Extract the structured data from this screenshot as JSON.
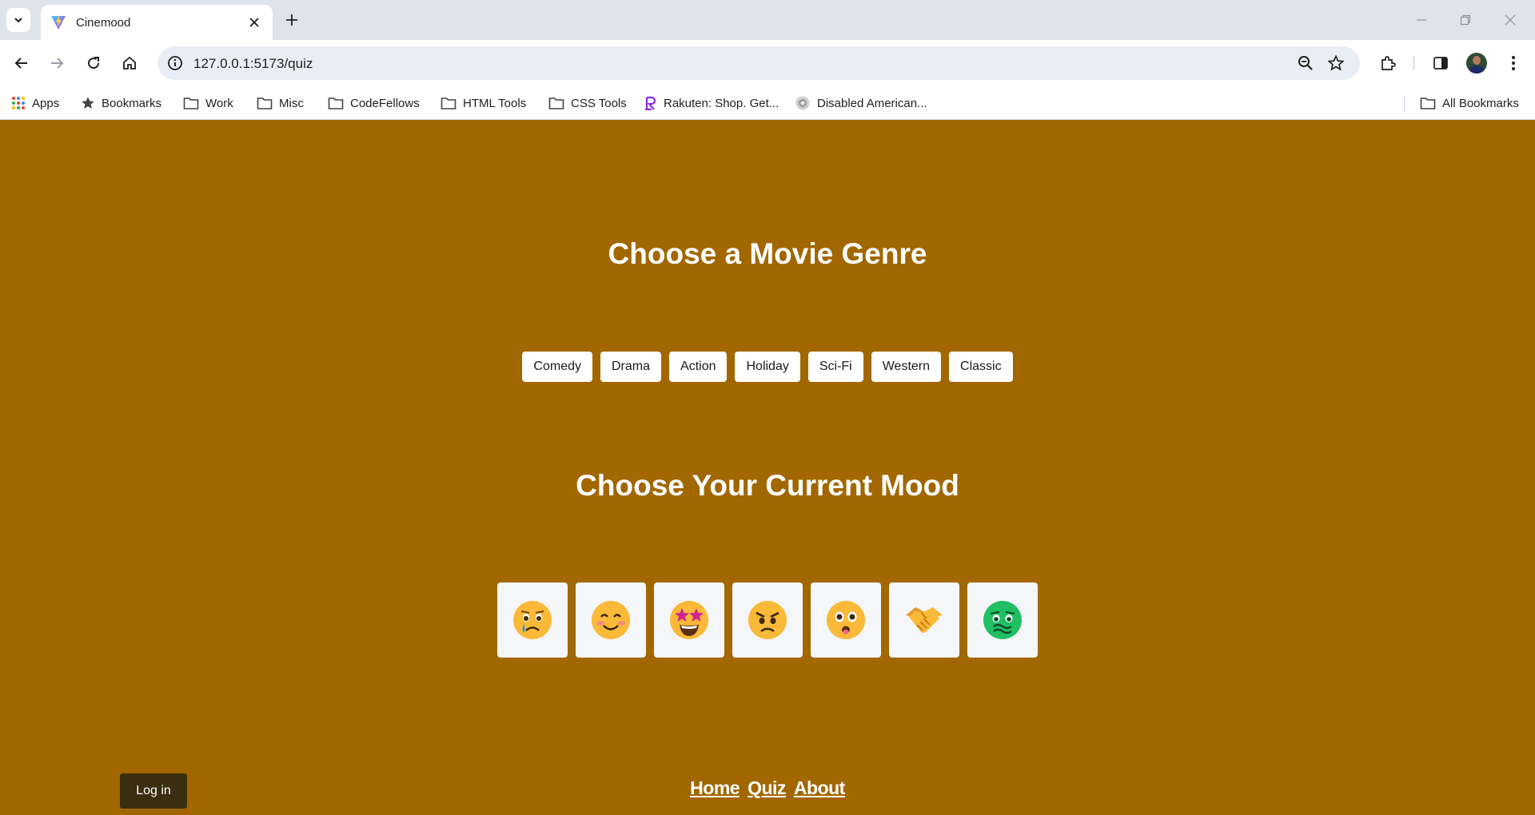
{
  "browser": {
    "tab_title": "Cinemood",
    "url": "127.0.0.1:5173/quiz",
    "bookmarks": [
      {
        "label": "Apps",
        "icon": "apps-grid-icon"
      },
      {
        "label": "Bookmarks",
        "icon": "star-icon"
      },
      {
        "label": "Work",
        "icon": "folder-icon"
      },
      {
        "label": "Misc",
        "icon": "folder-icon"
      },
      {
        "label": "CodeFellows",
        "icon": "folder-icon"
      },
      {
        "label": "HTML Tools",
        "icon": "folder-icon"
      },
      {
        "label": "CSS Tools",
        "icon": "folder-icon"
      },
      {
        "label": "Rakuten: Shop. Get...",
        "icon": "rakuten-icon"
      },
      {
        "label": "Disabled American...",
        "icon": "dav-icon"
      }
    ],
    "all_bookmarks_label": "All Bookmarks"
  },
  "page": {
    "genre_heading": "Choose a Movie Genre",
    "genres": [
      "Comedy",
      "Drama",
      "Action",
      "Holiday",
      "Sci-Fi",
      "Western",
      "Classic"
    ],
    "mood_heading": "Choose Your Current Mood",
    "moods": [
      {
        "name": "sad",
        "icon": "crying-face-icon"
      },
      {
        "name": "happy",
        "icon": "smiling-face-icon"
      },
      {
        "name": "excited",
        "icon": "star-struck-icon"
      },
      {
        "name": "angry",
        "icon": "angry-face-icon"
      },
      {
        "name": "surprised",
        "icon": "flushed-face-icon"
      },
      {
        "name": "friendly",
        "icon": "handshake-icon"
      },
      {
        "name": "sick",
        "icon": "nauseated-face-icon"
      }
    ],
    "login_label": "Log in",
    "footer_links": [
      "Home",
      "Quiz",
      "About"
    ]
  },
  "colors": {
    "page_background": "#a26700",
    "login_button": "#3a2e0f"
  }
}
